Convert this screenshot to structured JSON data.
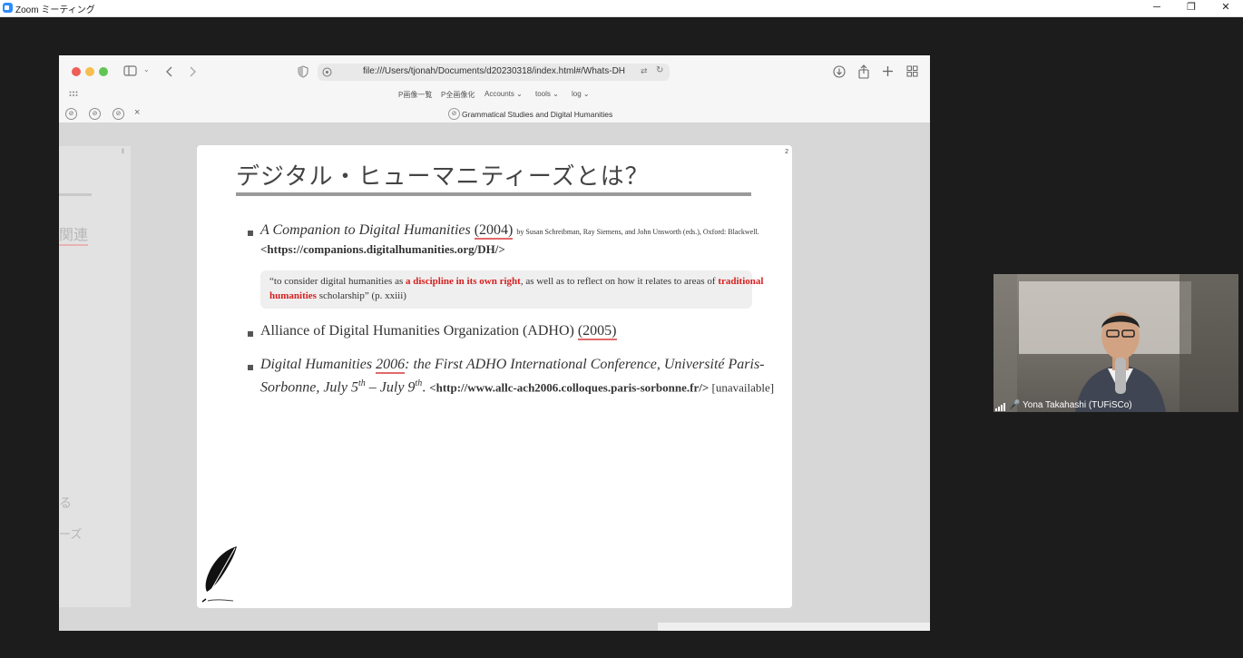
{
  "window": {
    "title": "Zoom ミーティング",
    "minimize_icon": "─",
    "restore_icon": "❐",
    "close_icon": "✕"
  },
  "browser": {
    "url": "file:///Users/tjonah/Documents/d20230318/index.html#/Whats-DH",
    "bookmarks": [
      "P画像一覧",
      "P全画像化",
      "Accounts ⌄",
      "tools ⌄",
      "log ⌄"
    ],
    "tab_title": "Grammatical Studies and Digital Humanities",
    "tab_close": "×"
  },
  "slide": {
    "number": "2",
    "title": "デジタル・ヒューマニティーズとは？",
    "item1": {
      "title": "A Companion to Digital Humanities",
      "year": "(2004)",
      "authors": "by Susan Schreibman, Ray Siemens, and John Unsworth (eds.), Oxford: Blackwell.",
      "url": "<https://companions.digitalhumanities.org/DH/>"
    },
    "quote": {
      "open": "“to consider digital humanities as ",
      "highlight1": "a discipline in its own right",
      "middle": ", as well as to reflect on how it relates to areas of ",
      "highlight2a": "traditional",
      "highlight2b": "humanities",
      "close": " scholarship” (p. xxiii)"
    },
    "item2": {
      "text": "Alliance of Digital Humanities Organization (ADHO) ",
      "year": "(2005)"
    },
    "item3": {
      "part1": "Digital Humanities ",
      "year": "2006",
      "part2": ": the First ADHO International Conference, Université Paris-",
      "part3": "Sorbonne, July 5",
      "sup1": "th",
      "part4": " – July 9",
      "sup2": "th",
      "part5": ". ",
      "url": "<http://www.allc-ach2006.colloques.paris-sorbonne.fr/>",
      "status": " [unavailable]"
    }
  },
  "side_slide": {
    "fragment1": "関連",
    "fragment2": "る",
    "fragment3": "ーズ"
  },
  "participant": {
    "name": "Yona Takahashi (TUFiSCo)"
  },
  "colors": {
    "accent_red": "#d62020",
    "underline": "#e06a6a",
    "zoom_blue": "#2d8cff"
  }
}
